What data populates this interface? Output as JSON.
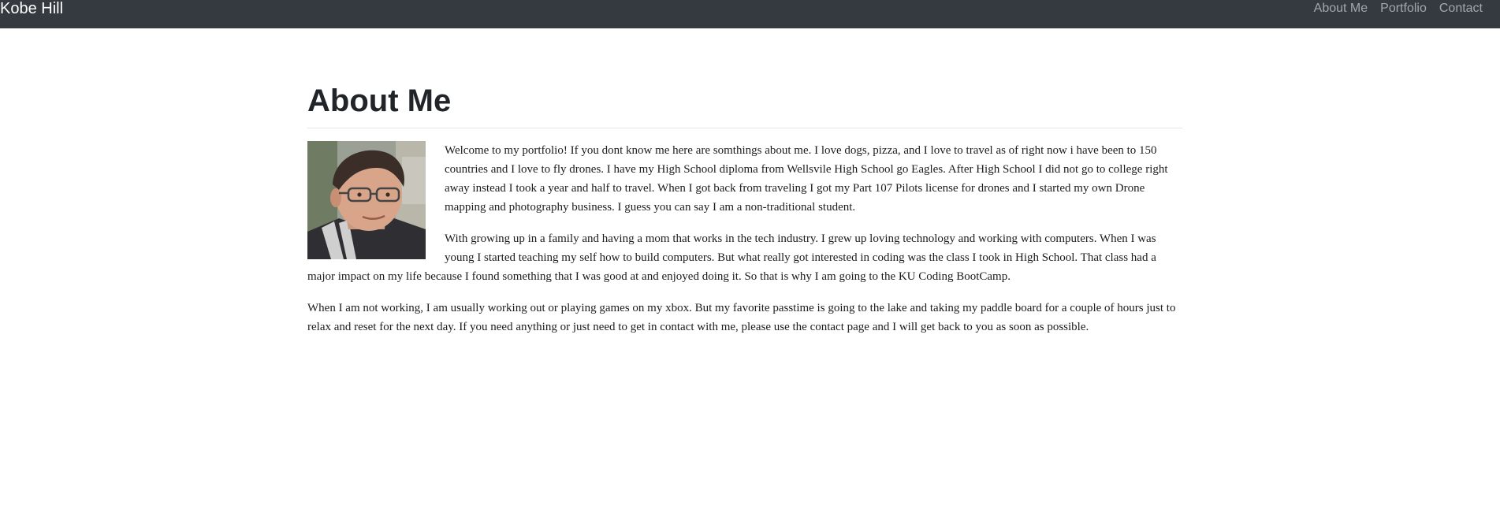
{
  "navbar": {
    "brand": "Kobe Hill",
    "links": [
      "About Me",
      "Portfolio",
      "Contact"
    ]
  },
  "main": {
    "title": "About Me",
    "avatar_alt": "Kobe Hill portrait",
    "paragraphs": [
      "Welcome to my portfolio! If you dont know me here are somthings about me. I love dogs, pizza, and I love to travel as of right now i have been to 150 countries and I love to fly drones. I have my High School diploma from Wellsvile High School go Eagles. After High School I did not go to college right away instead I took a year and half to travel. When I got back from traveling I got my Part 107 Pilots license for drones and I started my own Drone mapping and photography business. I guess you can say I am a non-traditional student.",
      "With growing up in a family and having a mom that works in the tech industry. I grew up loving technology and working with computers. When I was young I started teaching my self how to build computers. But what really got interested in coding was the class I took in High School. That class had a major impact on my life because I found something that I was good at and enjoyed doing it. So that is why I am going to the KU Coding BootCamp.",
      "When I am not working, I am usually working out or playing games on my xbox. But my favorite passtime is going to the lake and taking my paddle board for a couple of hours just to relax and reset for the next day. If you need anything or just need to get in contact with me, please use the contact page and I will get back to you as soon as possible."
    ]
  },
  "colors": {
    "navbar_bg": "#343a40",
    "brand": "#ffffff",
    "nav_link": "rgba(255,255,255,0.55)",
    "text": "#212529"
  }
}
